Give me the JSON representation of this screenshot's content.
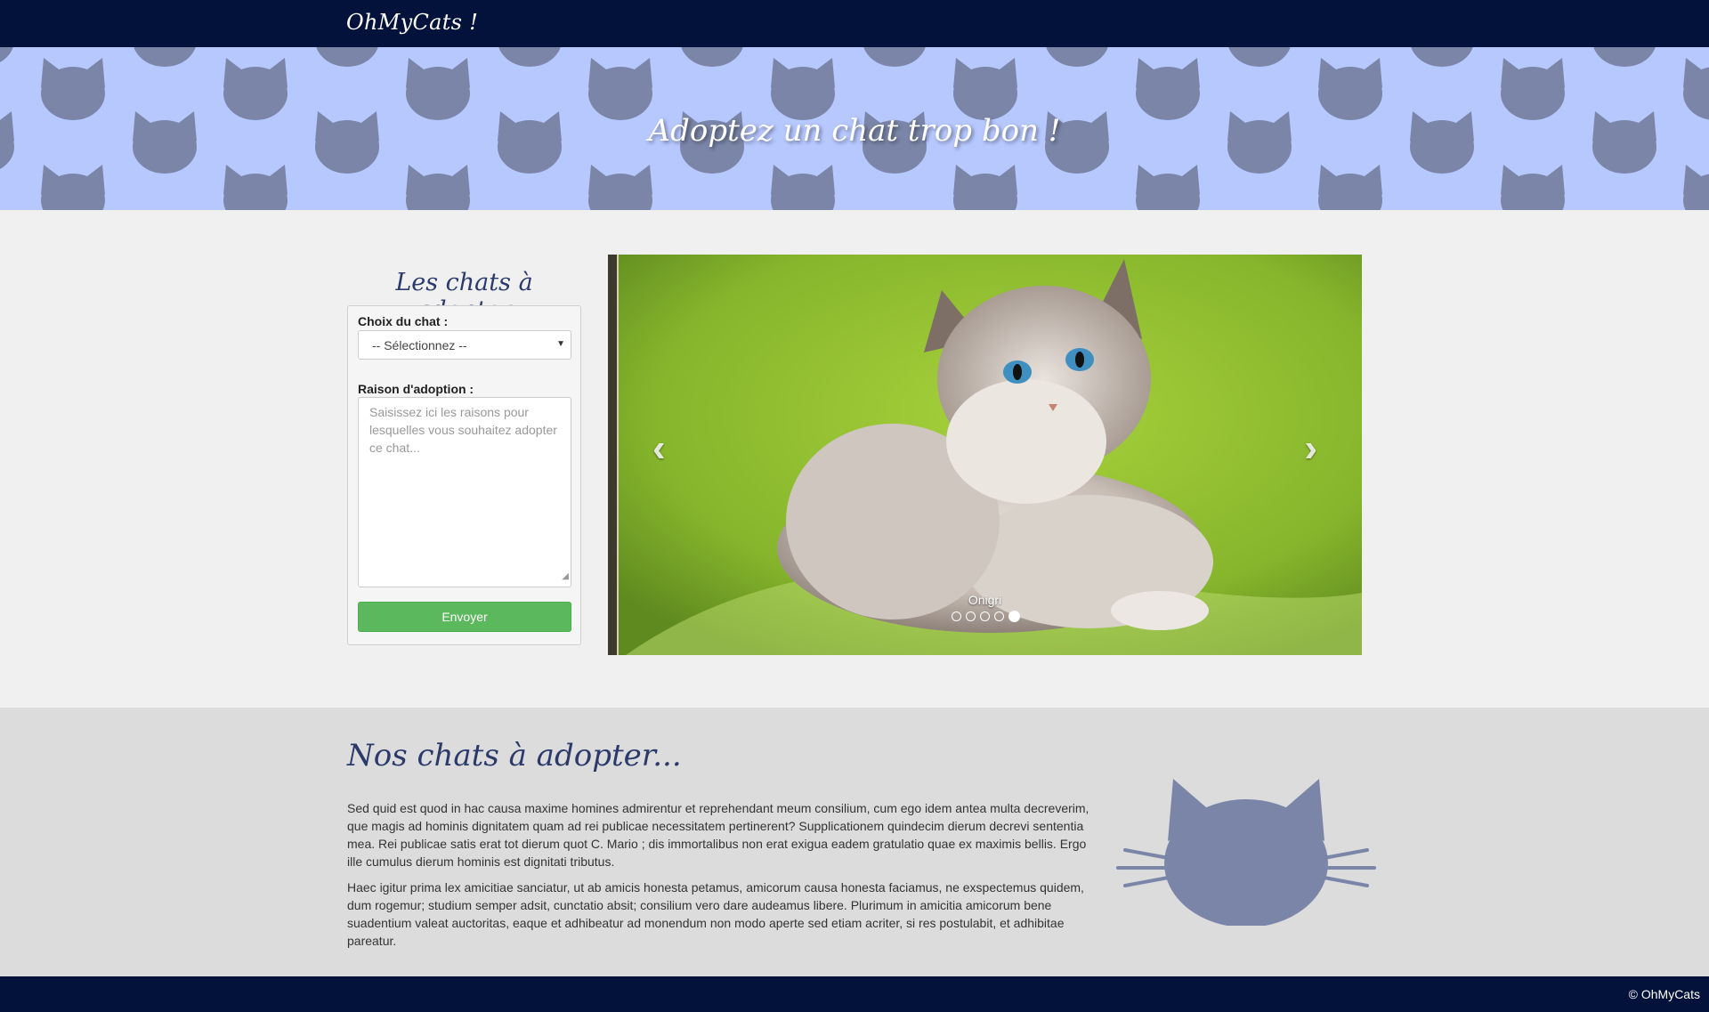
{
  "navbar": {
    "brand": "OhMyCats !"
  },
  "hero": {
    "title": "Adoptez un chat trop bon !",
    "background": "#b7c8ff",
    "pattern_icon": "cat-head-icon"
  },
  "form": {
    "title": "Les chats à adopter",
    "cat_choice_label": "Choix du chat :",
    "cat_choice_value": "-- Sélectionnez --",
    "reason_label": "Raison d'adoption :",
    "reason_placeholder": "Saisissez ici les raisons pour lesquelles vous souhaitez adopter ce chat...",
    "submit_label": "Envoyer",
    "submit_color": "#5cb85c"
  },
  "carousel": {
    "caption": "Onigri",
    "prev_icon": "chevron-left-icon",
    "next_icon": "chevron-right-icon",
    "slide_count": 5,
    "active_index": 4
  },
  "about": {
    "title": "Nos chats à adopter...",
    "paragraph1": "Sed quid est quod in hac causa maxime homines admirentur et reprehendant meum consilium, cum ego idem antea multa decreverim, que magis ad hominis dignitatem quam ad rei publicae necessitatem pertinerent? Supplicationem quindecim dierum decrevi sententia mea. Rei publicae satis erat tot dierum quot C. Mario ; dis immortalibus non erat exigua eadem gratulatio quae ex maximis bellis. Ergo ille cumulus dierum hominis est dignitati tributus.",
    "paragraph2": "Haec igitur prima lex amicitiae sanciatur, ut ab amicis honesta petamus, amicorum causa honesta faciamus, ne exspectemus quidem, dum rogemur; studium semper adsit, cunctatio absit; consilium vero dare audeamus libere. Plurimum in amicitia amicorum bene suadentium valeat auctoritas, eaque et adhibeatur ad monendum non modo aperte sed etiam acriter, si res postulabit, et adhibitae pareatur.",
    "illustration_icon": "cat-face-icon"
  },
  "footer": {
    "copyright": "© OhMyCats"
  },
  "colors": {
    "navy": "#02123a",
    "accent": "#2b3a6b",
    "cat_gray": "#7a85a8"
  }
}
